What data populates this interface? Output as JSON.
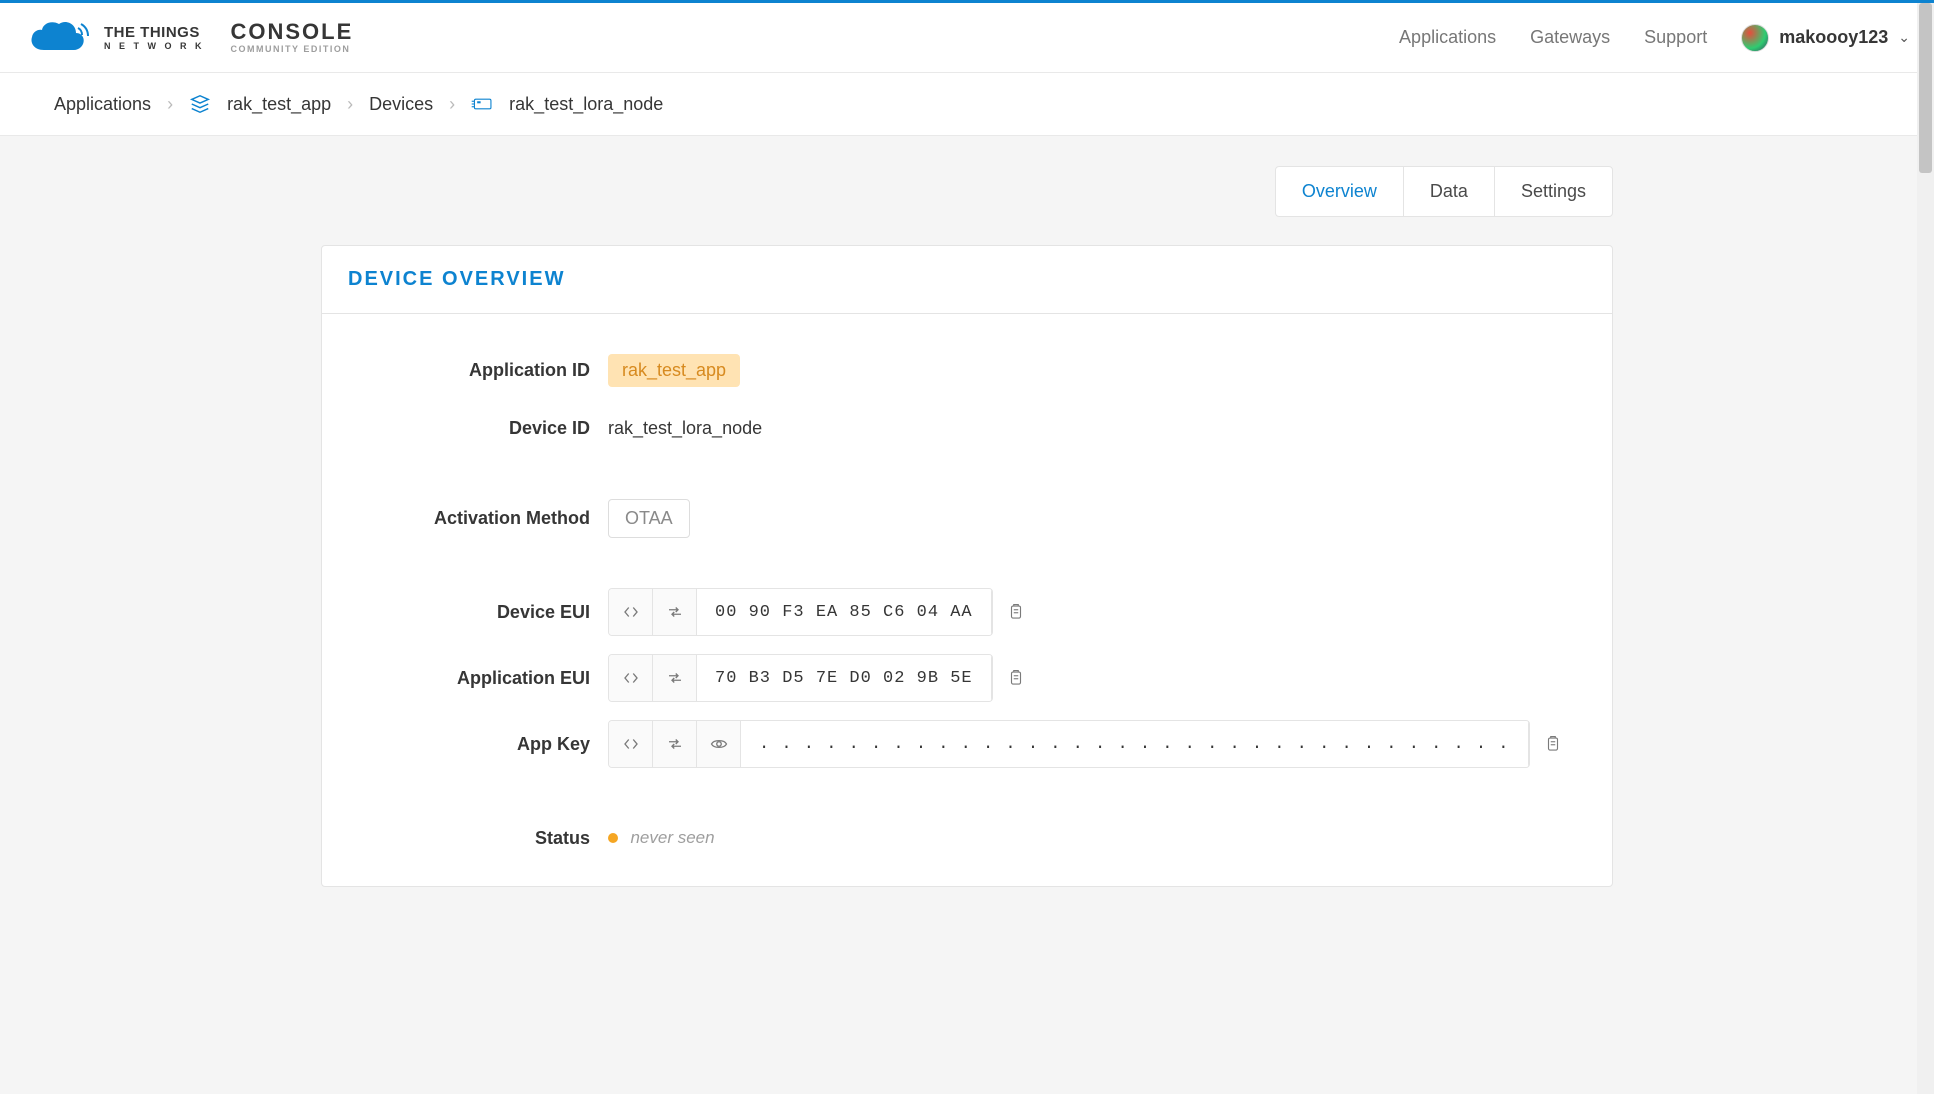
{
  "brand": {
    "title": "THE THINGS",
    "subtitle": "N E T W O R K",
    "console": "CONSOLE",
    "console_sub": "COMMUNITY EDITION"
  },
  "nav": {
    "applications": "Applications",
    "gateways": "Gateways",
    "support": "Support"
  },
  "user": {
    "name": "makoooy123"
  },
  "breadcrumb": {
    "root": "Applications",
    "app": "rak_test_app",
    "devices": "Devices",
    "device": "rak_test_lora_node"
  },
  "tabs": {
    "overview": "Overview",
    "data": "Data",
    "settings": "Settings"
  },
  "panel": {
    "title": "DEVICE OVERVIEW"
  },
  "fields": {
    "application_id_label": "Application ID",
    "application_id_value": "rak_test_app",
    "device_id_label": "Device ID",
    "device_id_value": "rak_test_lora_node",
    "activation_label": "Activation Method",
    "activation_value": "OTAA",
    "device_eui_label": "Device EUI",
    "device_eui_value": "00 90 F3 EA 85 C6 04 AA",
    "application_eui_label": "Application EUI",
    "application_eui_value": "70 B3 D5 7E D0 02 9B 5E",
    "app_key_label": "App Key",
    "app_key_value": ". . . . . . . . . . . . . . . . . . . . . . . . . . . . . . . . . .",
    "status_label": "Status",
    "status_value": "never seen"
  }
}
